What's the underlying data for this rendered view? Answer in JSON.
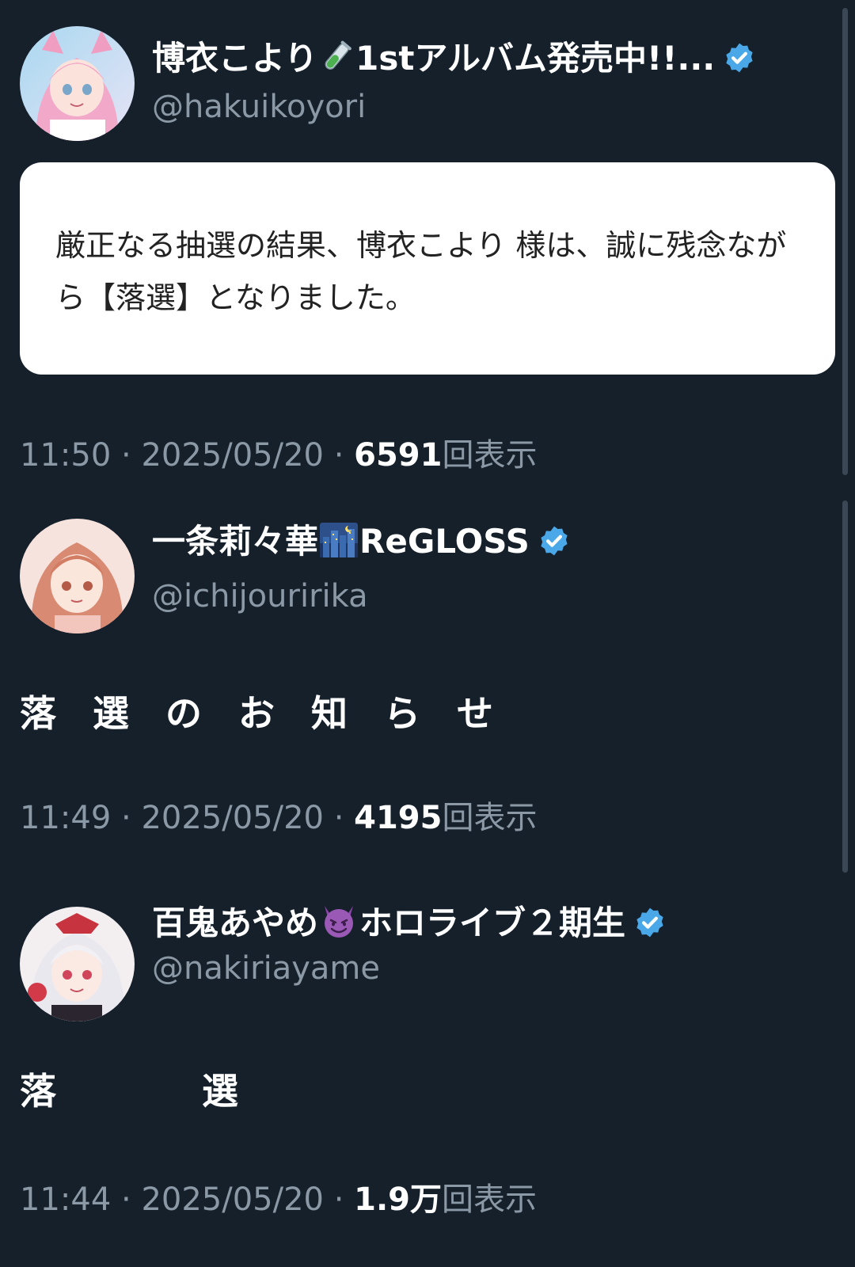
{
  "tweets": [
    {
      "display_name": "博衣こより",
      "name_emoji": "test-tube",
      "name_suffix": "1stアルバム発売中!!...",
      "handle": "@hakuikoyori",
      "card_text": "厳正なる抽選の結果、博衣こより 様は、誠に残念ながら【落選】となりました。",
      "time": "11:50",
      "date": "2025/05/20",
      "views": "6591",
      "views_label": "回表示"
    },
    {
      "display_name": "一条莉々華",
      "name_emoji": "night-city",
      "name_suffix": "ReGLOSS",
      "handle": "@ichijouririka",
      "body": "落　選　の　お　知　ら　せ",
      "time": "11:49",
      "date": "2025/05/20",
      "views": "4195",
      "views_label": "回表示"
    },
    {
      "display_name": "百鬼あやめ",
      "name_emoji": "smiling-devil",
      "name_suffix": "ホロライブ２期生",
      "handle": "@nakiriayame",
      "body": "落　　　　選",
      "time": "11:44",
      "date": "2025/05/20",
      "views": "1.9万",
      "views_label": "回表示"
    }
  ],
  "separator": " · ",
  "colors": {
    "background": "#16202b",
    "secondary_text": "#8b98a5",
    "verified_badge": "#4aa8e8",
    "card_background": "#ffffff"
  }
}
